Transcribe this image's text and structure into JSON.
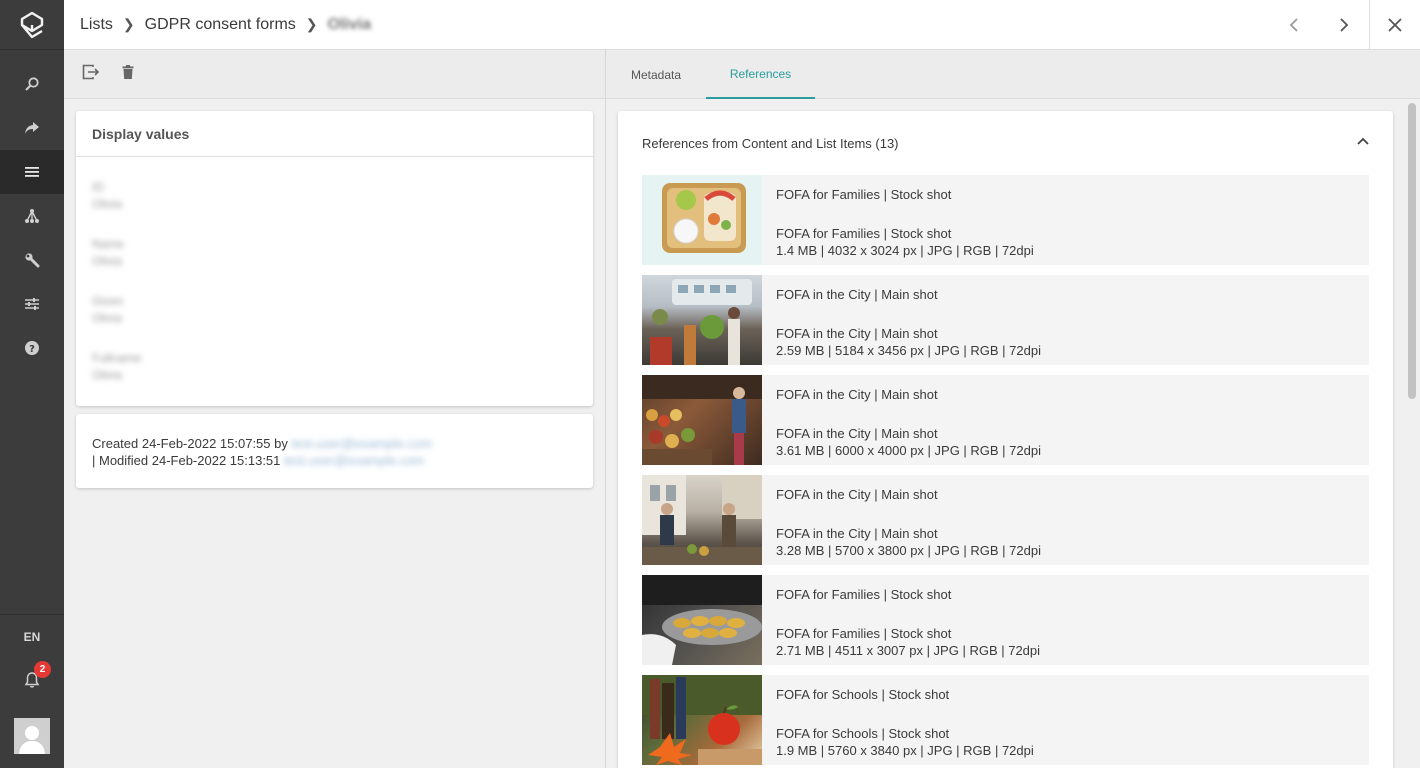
{
  "breadcrumb": {
    "items": [
      "Lists",
      "GDPR consent forms"
    ],
    "current": "Olivia"
  },
  "sidebar": {
    "items": [
      {
        "name": "search",
        "icon": "search-icon"
      },
      {
        "name": "share",
        "icon": "share-icon"
      },
      {
        "name": "lists",
        "icon": "list-icon",
        "active": true
      },
      {
        "name": "taxonomy",
        "icon": "hierarchy-icon"
      },
      {
        "name": "tools",
        "icon": "wrench-icon"
      },
      {
        "name": "settings",
        "icon": "sliders-icon"
      },
      {
        "name": "help",
        "icon": "help-icon"
      }
    ],
    "language": "EN",
    "notification_count": "2"
  },
  "display_card": {
    "title": "Display values",
    "fields": [
      {
        "label": "ID",
        "value": "Olivia"
      },
      {
        "label": "Name",
        "value": "Olivia"
      },
      {
        "label": "Given",
        "value": "Olivia"
      },
      {
        "label": "Fullname",
        "value": "Olivia"
      }
    ]
  },
  "info_card": {
    "created_text": "Created 24-Feb-2022 15:07:55 by",
    "created_by": "test.user@example.com",
    "modified_text": "| Modified 24-Feb-2022 15:13:51",
    "modified_by": "test.user@example.com"
  },
  "tabs": {
    "metadata": "Metadata",
    "references": "References"
  },
  "references": {
    "title": "References from Content and List Items (13)",
    "items": [
      {
        "title": "FOFA for Families | Stock shot",
        "subtitle": "FOFA for Families | Stock shot",
        "details": "1.4 MB | 4032 x 3024 px | JPG | RGB | 72dpi"
      },
      {
        "title": "FOFA in the City | Main shot",
        "subtitle": "FOFA in the City | Main shot",
        "details": "2.59 MB | 5184 x 3456 px | JPG | RGB | 72dpi"
      },
      {
        "title": "FOFA in the City | Main shot",
        "subtitle": "FOFA in the City | Main shot",
        "details": "3.61 MB | 6000 x 4000 px | JPG | RGB | 72dpi"
      },
      {
        "title": "FOFA in the City | Main shot",
        "subtitle": "FOFA in the City | Main shot",
        "details": "3.28 MB | 5700 x 3800 px | JPG | RGB | 72dpi"
      },
      {
        "title": "FOFA for Families | Stock shot",
        "subtitle": "FOFA for Families | Stock shot",
        "details": "2.71 MB | 4511 x 3007 px | JPG | RGB | 72dpi"
      },
      {
        "title": "FOFA for Schools | Stock shot",
        "subtitle": "FOFA for Schools | Stock shot",
        "details": "1.9 MB | 5760 x 3840 px | JPG | RGB | 72dpi"
      }
    ]
  },
  "colors": {
    "accent": "#2a9d9d",
    "rail": "#3c3c3c",
    "badge": "#e53935"
  }
}
